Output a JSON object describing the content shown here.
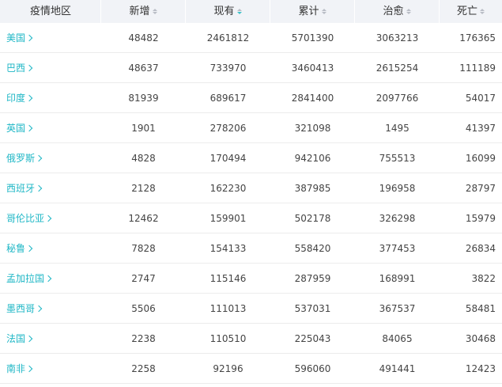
{
  "header": {
    "region": "疫情地区",
    "new": "新增",
    "current": "现有",
    "total": "累计",
    "healed": "治愈",
    "dead": "死亡"
  },
  "sort_active_column": "current",
  "colors": {
    "accent": "#1fb7c6",
    "header_bg": "#f1f3f7"
  },
  "rows": [
    {
      "region": "美国",
      "new": "48482",
      "current": "2461812",
      "total": "5701390",
      "healed": "3063213",
      "dead": "176365"
    },
    {
      "region": "巴西",
      "new": "48637",
      "current": "733970",
      "total": "3460413",
      "healed": "2615254",
      "dead": "111189"
    },
    {
      "region": "印度",
      "new": "81939",
      "current": "689617",
      "total": "2841400",
      "healed": "2097766",
      "dead": "54017"
    },
    {
      "region": "英国",
      "new": "1901",
      "current": "278206",
      "total": "321098",
      "healed": "1495",
      "dead": "41397"
    },
    {
      "region": "俄罗斯",
      "new": "4828",
      "current": "170494",
      "total": "942106",
      "healed": "755513",
      "dead": "16099"
    },
    {
      "region": "西班牙",
      "new": "2128",
      "current": "162230",
      "total": "387985",
      "healed": "196958",
      "dead": "28797"
    },
    {
      "region": "哥伦比亚",
      "new": "12462",
      "current": "159901",
      "total": "502178",
      "healed": "326298",
      "dead": "15979"
    },
    {
      "region": "秘鲁",
      "new": "7828",
      "current": "154133",
      "total": "558420",
      "healed": "377453",
      "dead": "26834"
    },
    {
      "region": "孟加拉国",
      "new": "2747",
      "current": "115146",
      "total": "287959",
      "healed": "168991",
      "dead": "3822"
    },
    {
      "region": "墨西哥",
      "new": "5506",
      "current": "111013",
      "total": "537031",
      "healed": "367537",
      "dead": "58481"
    },
    {
      "region": "法国",
      "new": "2238",
      "current": "110510",
      "total": "225043",
      "healed": "84065",
      "dead": "30468"
    },
    {
      "region": "南非",
      "new": "2258",
      "current": "92196",
      "total": "596060",
      "healed": "491441",
      "dead": "12423"
    }
  ]
}
